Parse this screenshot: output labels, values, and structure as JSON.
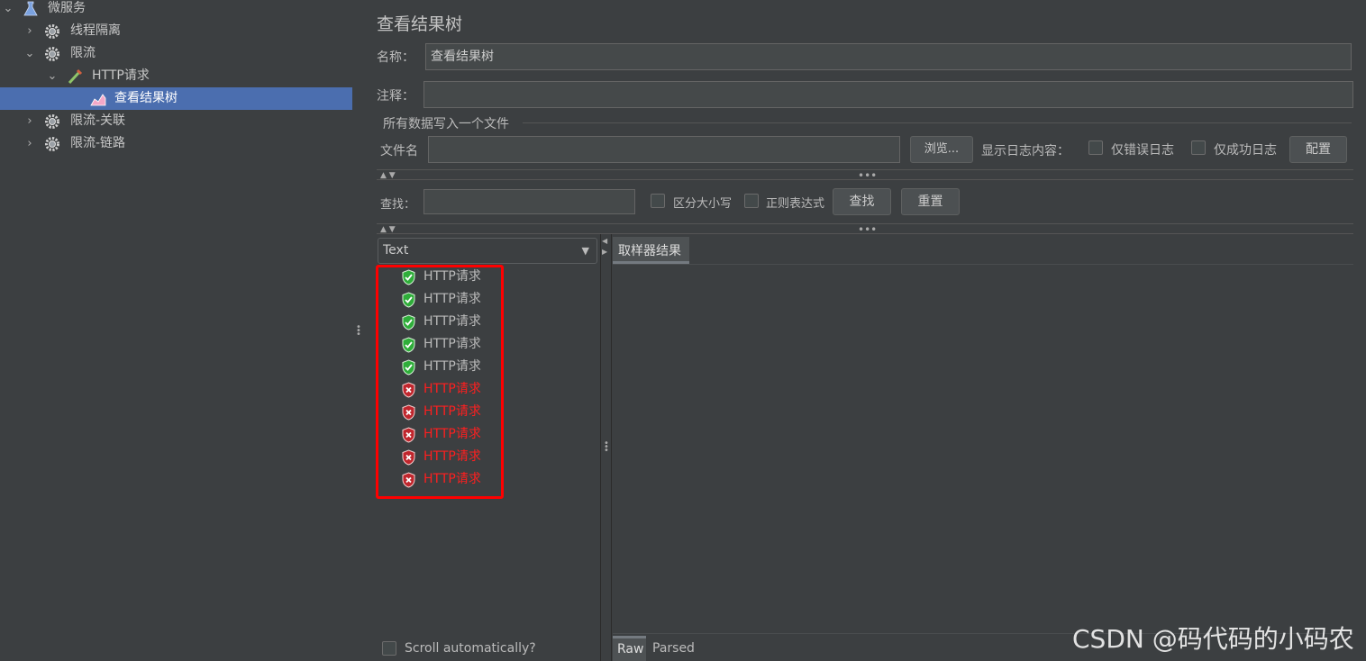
{
  "tree": {
    "items": [
      {
        "label": "微服务",
        "icon": "flask-icon",
        "expanded": true
      },
      {
        "label": "线程隔离",
        "icon": "gear-icon",
        "expanded": false
      },
      {
        "label": "限流",
        "icon": "gear-icon",
        "expanded": true
      },
      {
        "label": "HTTP请求",
        "icon": "pipette-icon",
        "expanded": true
      },
      {
        "label": "查看结果树",
        "icon": "chart-icon",
        "selected": true
      },
      {
        "label": "限流-关联",
        "icon": "gear-icon",
        "expanded": false
      },
      {
        "label": "限流-链路",
        "icon": "gear-icon",
        "expanded": false
      }
    ]
  },
  "panel": {
    "title": "查看结果树",
    "name_label": "名称：",
    "name_value": "查看结果树",
    "comment_label": "注释：",
    "comment_value": "",
    "file_section_title": "所有数据写入一个文件",
    "filename_label": "文件名",
    "filename_value": "",
    "browse_button": "浏览...",
    "log_content_label": "显示日志内容：",
    "errors_only_label": "仅错误日志",
    "success_only_label": "仅成功日志",
    "configure_button": "配置"
  },
  "search": {
    "label": "查找：",
    "value": "",
    "case_sensitive_label": "区分大小写",
    "regex_label": "正则表达式",
    "find_button": "查找",
    "reset_button": "重置"
  },
  "results": {
    "renderer": "Text",
    "items": [
      {
        "label": "HTTP请求",
        "status": "success"
      },
      {
        "label": "HTTP请求",
        "status": "success"
      },
      {
        "label": "HTTP请求",
        "status": "success"
      },
      {
        "label": "HTTP请求",
        "status": "success"
      },
      {
        "label": "HTTP请求",
        "status": "success"
      },
      {
        "label": "HTTP请求",
        "status": "error"
      },
      {
        "label": "HTTP请求",
        "status": "error"
      },
      {
        "label": "HTTP请求",
        "status": "error"
      },
      {
        "label": "HTTP请求",
        "status": "error"
      },
      {
        "label": "HTTP请求",
        "status": "error"
      }
    ],
    "scroll_auto_label": "Scroll automatically?",
    "sampler_tab": "取样器结果",
    "raw_tab": "Raw",
    "parsed_tab": "Parsed"
  },
  "watermark": "CSDN @码代码的小码农",
  "colors": {
    "background": "#3c3f41",
    "selection": "#4b6eaf",
    "error_text": "#ff1f1f",
    "highlight_box": "#ff0000",
    "success_icon": "#2fae3a",
    "error_icon": "#c0262d"
  }
}
